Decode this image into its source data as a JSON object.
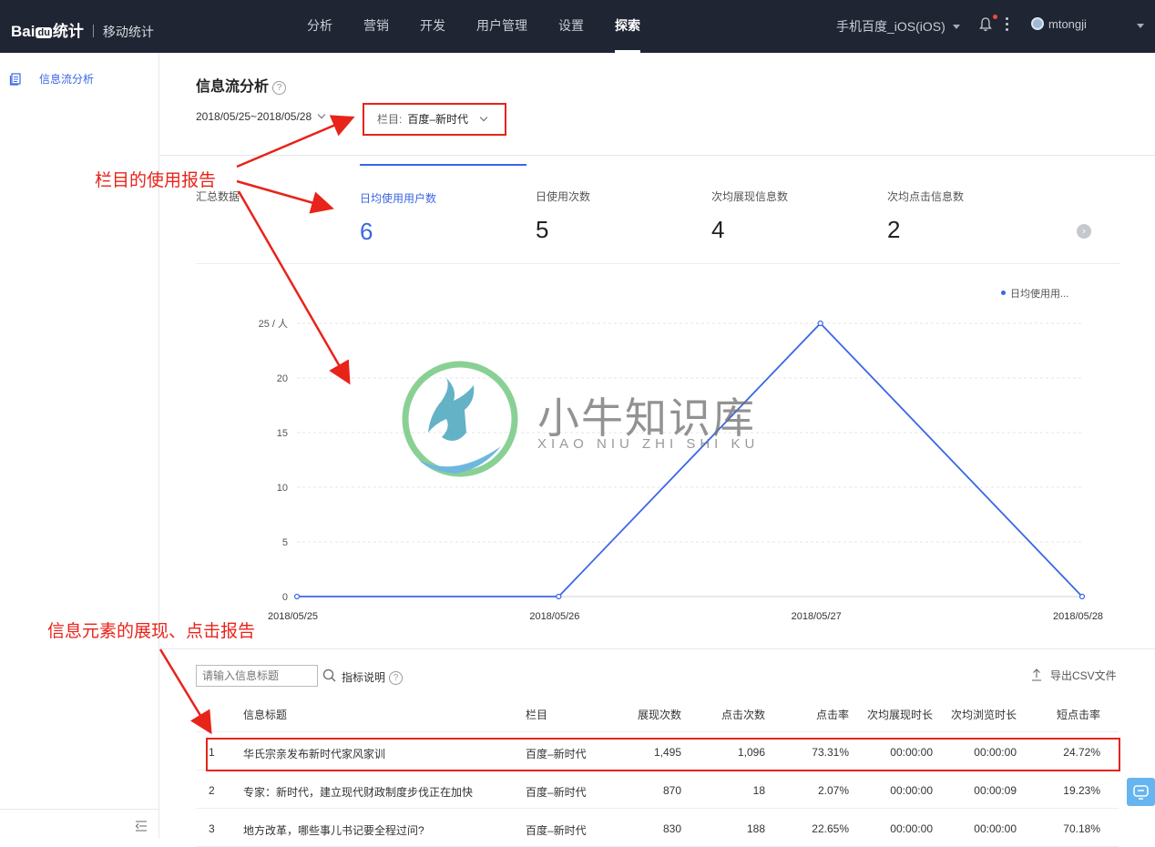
{
  "header": {
    "logo": "Bai",
    "logo_paw": "du",
    "logo_tongji": "统计",
    "product": "移动统计",
    "nav": [
      "分析",
      "营销",
      "开发",
      "用户管理",
      "设置",
      "探索"
    ],
    "active_nav": "探索",
    "app_name": "手机百度_iOS(iOS)",
    "user": "mtongji"
  },
  "sidebar": {
    "items": [
      {
        "label": "信息流分析",
        "icon": "document-icon"
      }
    ]
  },
  "page": {
    "title": "信息流分析",
    "date_range": "2018/05/25~2018/05/28",
    "column_label": "栏目:",
    "column_value": "百度–新时代"
  },
  "metrics": {
    "summary_label": "汇总数据",
    "tabs": [
      {
        "label": "日均使用用户数",
        "value": "6"
      },
      {
        "label": "日使用次数",
        "value": "5"
      },
      {
        "label": "次均展现信息数",
        "value": "4"
      },
      {
        "label": "次均点击信息数",
        "value": "2"
      }
    ]
  },
  "chart_data": {
    "type": "line",
    "x": [
      "2018/05/25",
      "2018/05/26",
      "2018/05/27",
      "2018/05/28"
    ],
    "series": [
      {
        "name": "日均使用用...",
        "values": [
          0,
          0,
          25,
          0
        ],
        "color": "#3b66e6"
      }
    ],
    "y_ticks": [
      "0",
      "5",
      "10",
      "15",
      "20",
      "25 / 人"
    ],
    "ylim": [
      0,
      25
    ],
    "grid": true,
    "legend_position": "top-right"
  },
  "watermark": {
    "text": "小牛知识库",
    "sub": "XIAO NIU ZHI SHI KU"
  },
  "table": {
    "search_placeholder": "请输入信息标题",
    "metric_help": "指标说明",
    "export": "导出CSV文件",
    "headers": [
      "信息标题",
      "栏目",
      "展现次数",
      "点击次数",
      "点击率",
      "次均展现时长",
      "次均浏览时长",
      "短点击率"
    ],
    "rows": [
      [
        "1",
        "华氏宗亲发布新时代家风家训",
        "百度–新时代",
        "1,495",
        "1,096",
        "73.31%",
        "00:00:00",
        "00:00:00",
        "24.72%"
      ],
      [
        "2",
        "专家：新时代，建立现代财政制度步伐正在加快",
        "百度–新时代",
        "870",
        "18",
        "2.07%",
        "00:00:00",
        "00:00:09",
        "19.23%"
      ],
      [
        "3",
        "地方改革，哪些事儿书记要全程过问?",
        "百度–新时代",
        "830",
        "188",
        "22.65%",
        "00:00:00",
        "00:00:00",
        "70.18%"
      ]
    ]
  },
  "annotations": {
    "column_report": "栏目的使用报告",
    "element_report": "信息元素的展现、点击报告",
    "color": "#e8231a"
  }
}
